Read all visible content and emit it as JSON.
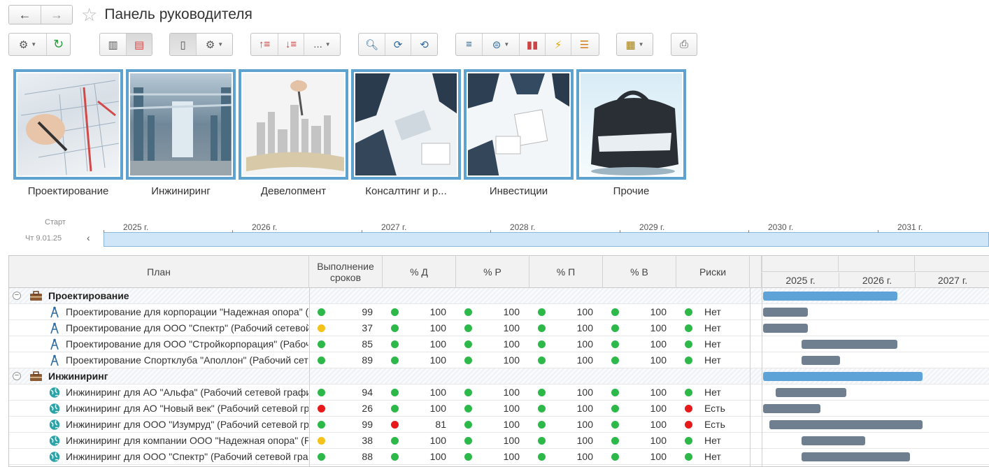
{
  "window": {
    "title": "Панель руководителя"
  },
  "nav": {
    "back": "←",
    "forward": "→"
  },
  "toolbar": {
    "more_label": "..."
  },
  "tiles": [
    {
      "label": "Проектирование"
    },
    {
      "label": "Инжиниринг"
    },
    {
      "label": "Девелопмент"
    },
    {
      "label": "Консалтинг и р..."
    },
    {
      "label": "Инвестиции"
    },
    {
      "label": "Прочие"
    }
  ],
  "timeline": {
    "start_label": "Старт",
    "start_date": "Чт 9.01.25",
    "years": [
      "2025 г.",
      "2026 г.",
      "2027 г.",
      "2028 г.",
      "2029 г.",
      "2030 г.",
      "2031 г."
    ]
  },
  "table": {
    "columns": {
      "plan": "План",
      "deadline": "Выполнение сроков",
      "d": "% Д",
      "r": "% Р",
      "p": "% П",
      "v": "% В",
      "risks": "Риски"
    },
    "gantt_years": [
      "2025 г.",
      "2026 г.",
      "2027 г."
    ],
    "rows": [
      {
        "type": "group",
        "name": "Проектирование",
        "bar_color": "#5ea3d7"
      },
      {
        "type": "item",
        "icon": "compass-icon",
        "name": "Проектирование для корпорации \"Надежная опора\" (Рабочий сетевой график)",
        "deadline": "99",
        "deadline_status": "green",
        "d": "100",
        "d_status": "green",
        "r": "100",
        "r_status": "green",
        "p": "100",
        "p_status": "green",
        "v": "100",
        "v_status": "green",
        "risk": "Нет",
        "risk_status": "green",
        "bar_start": "2025-01",
        "bar_end": "2025-08"
      },
      {
        "type": "item",
        "icon": "compass-icon",
        "name": "Проектирование для ООО \"Спектр\" (Рабочий сетевой график)",
        "deadline": "37",
        "deadline_status": "yellow",
        "d": "100",
        "d_status": "green",
        "r": "100",
        "r_status": "green",
        "p": "100",
        "p_status": "green",
        "v": "100",
        "v_status": "green",
        "risk": "Нет",
        "risk_status": "green",
        "bar_start": "2025-01",
        "bar_end": "2025-08"
      },
      {
        "type": "item",
        "icon": "compass-icon",
        "name": "Проектирование для ООО \"Стройкорпорация\" (Рабочий сетевой график)",
        "deadline": "85",
        "deadline_status": "green",
        "d": "100",
        "d_status": "green",
        "r": "100",
        "r_status": "green",
        "p": "100",
        "p_status": "green",
        "v": "100",
        "v_status": "green",
        "risk": "Нет",
        "risk_status": "green",
        "bar_start": "2025-07",
        "bar_end": "2026-10"
      },
      {
        "type": "item",
        "icon": "compass-icon",
        "name": "Проектирование Спортклуба \"Аполлон\" (Рабочий сетевой график)",
        "deadline": "89",
        "deadline_status": "green",
        "d": "100",
        "d_status": "green",
        "r": "100",
        "r_status": "green",
        "p": "100",
        "p_status": "green",
        "v": "100",
        "v_status": "green",
        "risk": "Нет",
        "risk_status": "green",
        "bar_start": "2025-07",
        "bar_end": "2026-01"
      },
      {
        "type": "group",
        "name": "Инжиниринг",
        "bar_color": "#5ea3d7"
      },
      {
        "type": "item",
        "icon": "globe-icon",
        "name": "Инжиниринг для АО \"Альфа\" (Рабочий сетевой график)",
        "deadline": "94",
        "deadline_status": "green",
        "d": "100",
        "d_status": "green",
        "r": "100",
        "r_status": "green",
        "p": "100",
        "p_status": "green",
        "v": "100",
        "v_status": "green",
        "risk": "Нет",
        "risk_status": "green",
        "bar_start": "2025-03",
        "bar_end": "2026-02"
      },
      {
        "type": "item",
        "icon": "globe-icon",
        "name": "Инжиниринг для АО \"Новый век\" (Рабочий сетевой график)",
        "deadline": "26",
        "deadline_status": "red",
        "d": "100",
        "d_status": "green",
        "r": "100",
        "r_status": "green",
        "p": "100",
        "p_status": "green",
        "v": "100",
        "v_status": "green",
        "risk": "Есть",
        "risk_status": "red",
        "bar_start": "2025-01",
        "bar_end": "2025-10"
      },
      {
        "type": "item",
        "icon": "globe-icon",
        "name": "Инжиниринг для ООО \"Изумруд\" (Рабочий сетевой график)",
        "deadline": "99",
        "deadline_status": "green",
        "d": "81",
        "d_status": "red",
        "r": "100",
        "r_status": "green",
        "p": "100",
        "p_status": "green",
        "v": "100",
        "v_status": "green",
        "risk": "Есть",
        "risk_status": "red",
        "bar_start": "2025-02",
        "bar_end": "2027-02"
      },
      {
        "type": "item",
        "icon": "globe-icon",
        "name": "Инжиниринг для компании ООО \"Надежная опора\" (Рабочий сетевой график)",
        "deadline": "38",
        "deadline_status": "yellow",
        "d": "100",
        "d_status": "green",
        "r": "100",
        "r_status": "green",
        "p": "100",
        "p_status": "green",
        "v": "100",
        "v_status": "green",
        "risk": "Нет",
        "risk_status": "green",
        "bar_start": "2025-07",
        "bar_end": "2026-05"
      },
      {
        "type": "item",
        "icon": "globe-icon",
        "name": "Инжиниринг для ООО \"Спектр\" (Рабочий сетевой график)",
        "deadline": "88",
        "deadline_status": "green",
        "d": "100",
        "d_status": "green",
        "r": "100",
        "r_status": "green",
        "p": "100",
        "p_status": "green",
        "v": "100",
        "v_status": "green",
        "risk": "Нет",
        "risk_status": "green",
        "bar_start": "2025-07",
        "bar_end": "2026-12"
      }
    ],
    "group_bars": [
      {
        "start": "2025-01",
        "end": "2026-10"
      },
      {
        "start": "2025-01",
        "end": "2027-02"
      }
    ]
  },
  "colors": {
    "green": "#2db84a",
    "yellow": "#f5c21b",
    "red": "#e8191b",
    "bar": "#6f7f8f",
    "group_bar": "#5ea3d7",
    "tile_border": "#5ea3d0"
  }
}
